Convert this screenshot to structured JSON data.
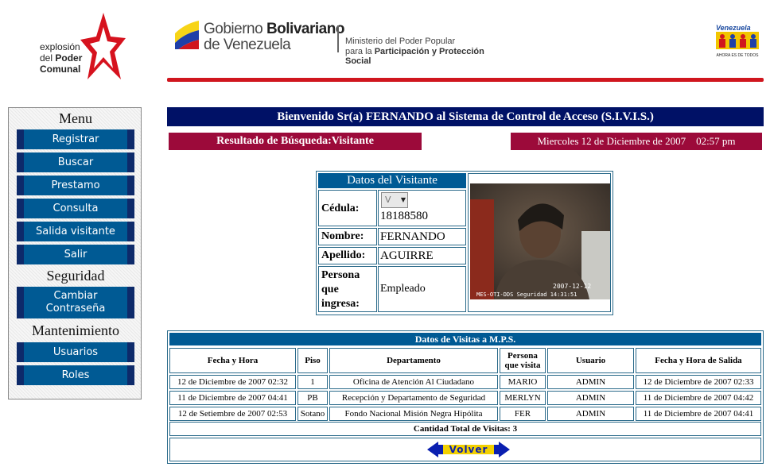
{
  "header": {
    "logo_left": {
      "line1": "explosión",
      "line2_a": "del ",
      "line2_b": "Poder",
      "line3": "Comunal"
    },
    "gov_line1_a": "Gobierno ",
    "gov_line1_b": "Bolivariano",
    "gov_line2": "de Venezuela",
    "ministry_line1": "Ministerio del Poder Popular",
    "ministry_line2_a": "para la ",
    "ministry_line2_b": "Participación y Protección Social",
    "logo_right_title": "Venezuela",
    "logo_right_sub": "AHORA ES DE TODOS"
  },
  "sidebar": {
    "sections": [
      {
        "title": "Menu",
        "items": [
          "Registrar",
          "Buscar",
          "Prestamo",
          "Consulta",
          "Salida visitante",
          "Salir"
        ]
      },
      {
        "title": "Seguridad",
        "items": [
          "Cambiar Contraseña"
        ]
      },
      {
        "title": "Mantenimiento",
        "items": [
          "Usuarios",
          "Roles"
        ]
      }
    ]
  },
  "welcome": "Bienvenido Sr(a) FERNANDO al Sistema de Control de Acceso (S.I.V.I.S.)",
  "result_title": "Resultado de Búsqueda:Visitante",
  "datetime": "Miercoles 12 de Diciembre de 2007    02:57 pm",
  "visitor": {
    "title": "Datos del Visitante",
    "cedula_label": "Cédula:",
    "cedula_type": "V",
    "cedula_value": "18188580",
    "nombre_label": "Nombre:",
    "nombre_value": "FERNANDO",
    "apellido_label": "Apellido:",
    "apellido_value": "AGUIRRE",
    "persona_label": "Persona que ingresa:",
    "persona_value": "Empleado",
    "photo_stamp_line1": "2007-12-12",
    "photo_stamp_line2": "MES-OTI-DDS Seguridad 14:31:51"
  },
  "visits": {
    "title": "Datos de Visitas a M.P.S.",
    "headers": [
      "Fecha y Hora",
      "Piso",
      "Departamento",
      "Persona que visita",
      "Usuario",
      "Fecha y Hora de Salida"
    ],
    "rows": [
      [
        "12 de Diciembre de 2007 02:32",
        "1",
        "Oficina de Atención Al Ciudadano",
        "MARIO",
        "ADMIN",
        "12 de Diciembre de 2007 02:33"
      ],
      [
        "11 de Diciembre de 2007 04:41",
        "PB",
        "Recepción y Departamento de Seguridad",
        "MERLYN",
        "ADMIN",
        "11 de Diciembre de 2007 04:42"
      ],
      [
        "12 de Setiembre de 2007 02:53",
        "Sotano",
        "Fondo Nacional Misión Negra Hipólita",
        "FER",
        "ADMIN",
        "11 de Diciembre de 2007 04:41"
      ]
    ],
    "total": "Cantidad Total de Visitas: 3",
    "back_label": "Volver"
  },
  "colors": {
    "header_bar": "#001166",
    "menu_button": "#005a94",
    "section_title_bar": "#9c0a3a",
    "red_line": "#d0161e"
  }
}
